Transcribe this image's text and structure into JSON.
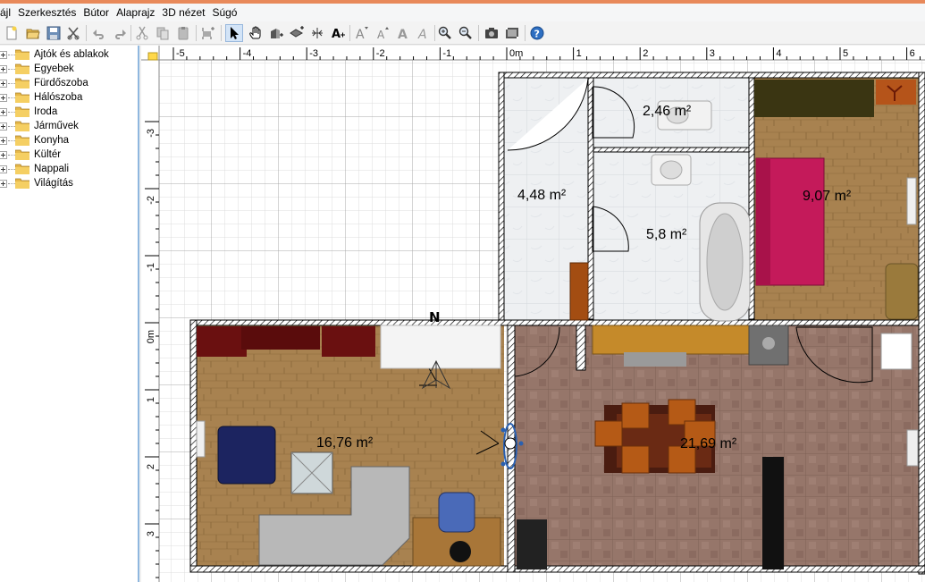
{
  "menu": [
    "ájl",
    "Szerkesztés",
    "Bútor",
    "Alaprajz",
    "3D nézet",
    "Súgó"
  ],
  "toolbar_icons": [
    "new-file-icon",
    "open-file-icon",
    "save-icon",
    "cut-tools-icon",
    "undo-icon",
    "redo-icon",
    "cut-icon",
    "copy-icon",
    "paste-icon",
    "add-furniture-icon",
    "select-arrow-icon",
    "pan-hand-icon",
    "create-walls-icon",
    "create-rooms-icon",
    "create-dimensions-icon",
    "add-text-icon",
    "text-size-increase-icon",
    "text-size-decrease-icon",
    "bold-text-icon",
    "italic-text-icon",
    "text-style-icon",
    "zoom-in-icon",
    "zoom-out-icon",
    "create-photo-icon",
    "create-video-icon",
    "help-icon"
  ],
  "catalog": [
    {
      "label": "Ajtók és ablakok"
    },
    {
      "label": "Egyebek"
    },
    {
      "label": "Fürdőszoba"
    },
    {
      "label": "Hálószoba"
    },
    {
      "label": "Iroda"
    },
    {
      "label": "Járművek"
    },
    {
      "label": "Konyha"
    },
    {
      "label": "Kültér"
    },
    {
      "label": "Nappali"
    },
    {
      "label": "Világítás"
    }
  ],
  "plan": {
    "top_ruler_labels": [
      "-5",
      "-4",
      "-3",
      "-2",
      "-1",
      "0m",
      "1",
      "2",
      "3",
      "4",
      "5",
      "6"
    ],
    "left_ruler_labels": [
      "-3",
      "-2",
      "-1",
      "0m",
      "1",
      "2",
      "3"
    ],
    "compass": "N",
    "rooms": [
      {
        "area": "2,46 m²"
      },
      {
        "area": "4,48 m²"
      },
      {
        "area": "5,8 m²"
      },
      {
        "area": "9,07 m²"
      },
      {
        "area": "16,76 m²"
      },
      {
        "area": "21,69 m²"
      }
    ]
  },
  "colors": {
    "accent": "#e8895a",
    "selection": "#d3e4f7",
    "tree_border": "#8fb7df",
    "wall": "#ffffff"
  }
}
